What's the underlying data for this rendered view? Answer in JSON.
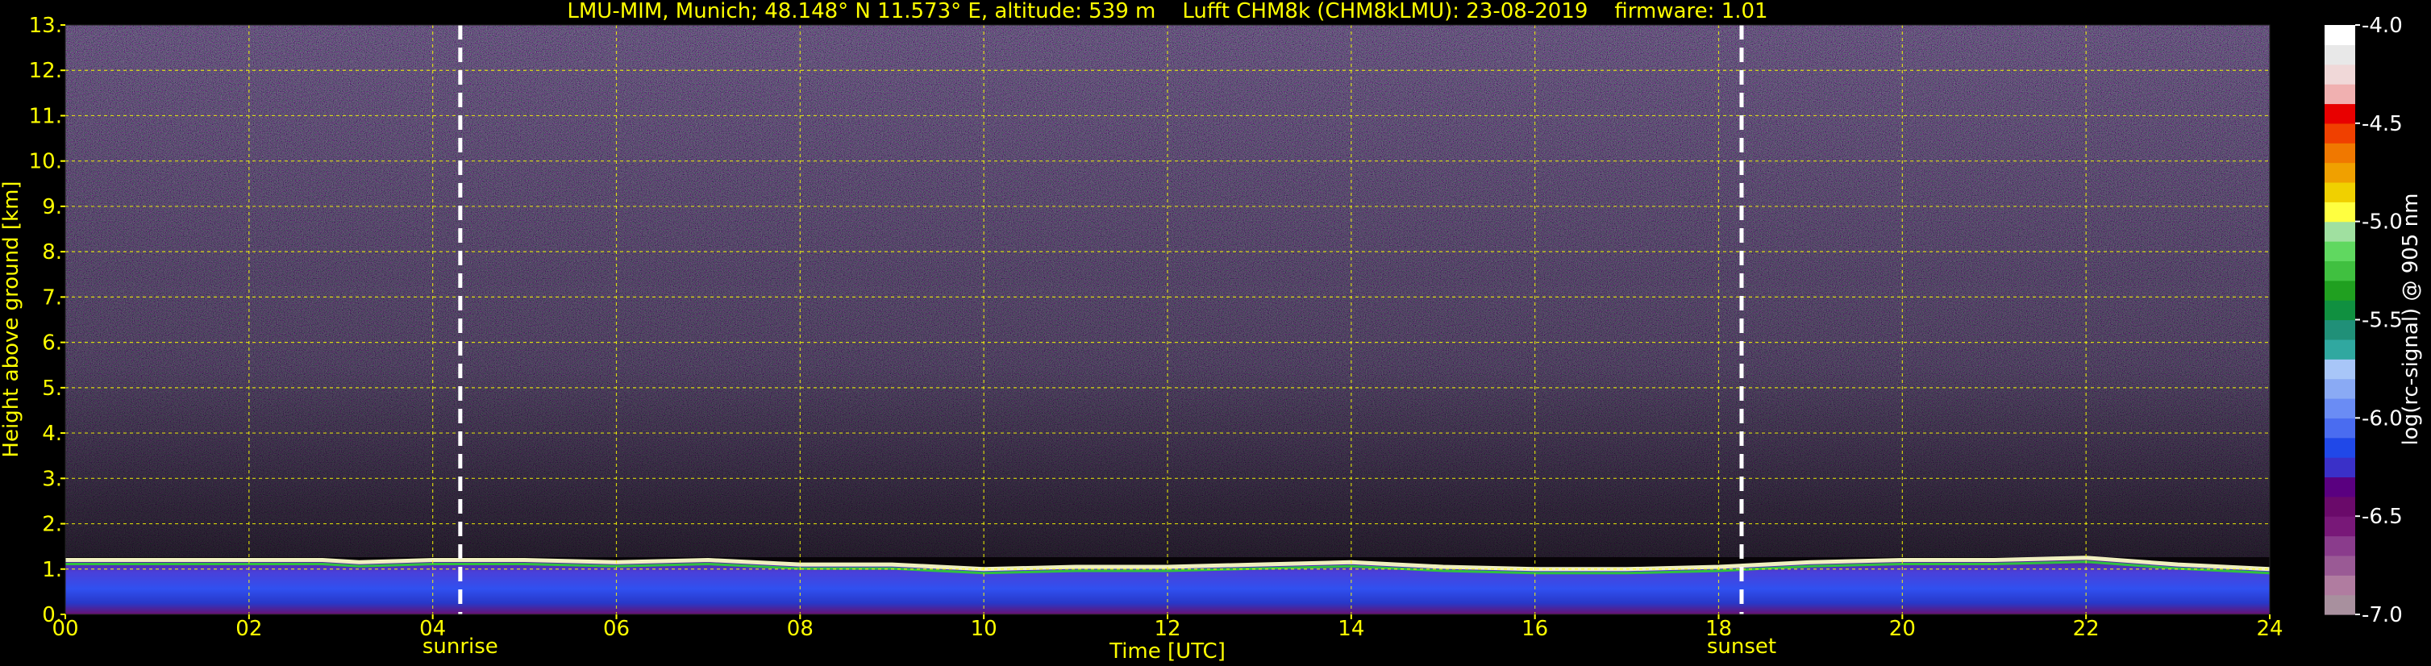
{
  "chart_data": {
    "type": "heatmap",
    "title": "LMU-MIM, Munich; 48.148° N 11.573° E, altitude: 539 m    Lufft CHM8k (CHM8kLMU): 23-08-2019    firmware: 1.01",
    "xlabel": "Time [UTC]",
    "ylabel": "Height above ground [km]",
    "xlim": [
      0,
      24
    ],
    "ylim": [
      0,
      13
    ],
    "x_ticks": [
      "00",
      "02",
      "04",
      "06",
      "08",
      "10",
      "12",
      "14",
      "16",
      "18",
      "20",
      "22",
      "24"
    ],
    "x_tick_values": [
      0,
      2,
      4,
      6,
      8,
      10,
      12,
      14,
      16,
      18,
      20,
      22,
      24
    ],
    "y_ticks": [
      "0.",
      "1.",
      "2.",
      "3.",
      "4.",
      "5.",
      "6.",
      "7.",
      "8.",
      "9.",
      "10.",
      "11.",
      "12.",
      "13."
    ],
    "y_tick_values": [
      0,
      1,
      2,
      3,
      4,
      5,
      6,
      7,
      8,
      9,
      10,
      11,
      12,
      13
    ],
    "grid": true,
    "grid_color": "#ffff00",
    "text_color": "#ffff00",
    "background": "#000000",
    "events": [
      {
        "label": "sunrise",
        "time": 4.3
      },
      {
        "label": "sunset",
        "time": 18.25
      }
    ],
    "boundary_layer_top_km": [
      [
        0,
        1.2
      ],
      [
        1,
        1.2
      ],
      [
        2,
        1.2
      ],
      [
        2.8,
        1.2
      ],
      [
        3.2,
        1.15
      ],
      [
        4,
        1.2
      ],
      [
        5,
        1.2
      ],
      [
        6,
        1.15
      ],
      [
        7,
        1.2
      ],
      [
        8,
        1.1
      ],
      [
        9,
        1.1
      ],
      [
        10,
        1.0
      ],
      [
        11,
        1.05
      ],
      [
        12,
        1.05
      ],
      [
        13,
        1.1
      ],
      [
        14,
        1.15
      ],
      [
        15,
        1.05
      ],
      [
        16,
        1.0
      ],
      [
        17,
        1.0
      ],
      [
        18,
        1.05
      ],
      [
        19,
        1.15
      ],
      [
        20,
        1.2
      ],
      [
        21,
        1.2
      ],
      [
        22,
        1.25
      ],
      [
        23,
        1.1
      ],
      [
        24,
        1.0
      ]
    ],
    "colorbar": {
      "label": "log(rc-signal) @ 905 nm",
      "range": [
        -7.0,
        -4.0
      ],
      "tick_labels": [
        "-4.0",
        "-4.5",
        "-5.0",
        "-5.5",
        "-6.0",
        "-6.5",
        "-7.0"
      ],
      "tick_values": [
        -4.0,
        -4.5,
        -5.0,
        -5.5,
        -6.0,
        -6.5,
        -7.0
      ],
      "colors": [
        "#a8909e",
        "#b07ca0",
        "#9a5a95",
        "#8a3c8c",
        "#781878",
        "#6a0a6a",
        "#5a0080",
        "#3a30c8",
        "#2048e8",
        "#4a6cf0",
        "#6a8cf4",
        "#8aaaf4",
        "#a8c6f8",
        "#30a8a0",
        "#209078",
        "#109040",
        "#20a020",
        "#40c040",
        "#60d860",
        "#a0e0a0",
        "#ffff40",
        "#f0d000",
        "#f0a000",
        "#f07800",
        "#f04000",
        "#e80000",
        "#f0b0b0",
        "#f0d8d8",
        "#e8e8e8",
        "#ffffff"
      ]
    }
  }
}
